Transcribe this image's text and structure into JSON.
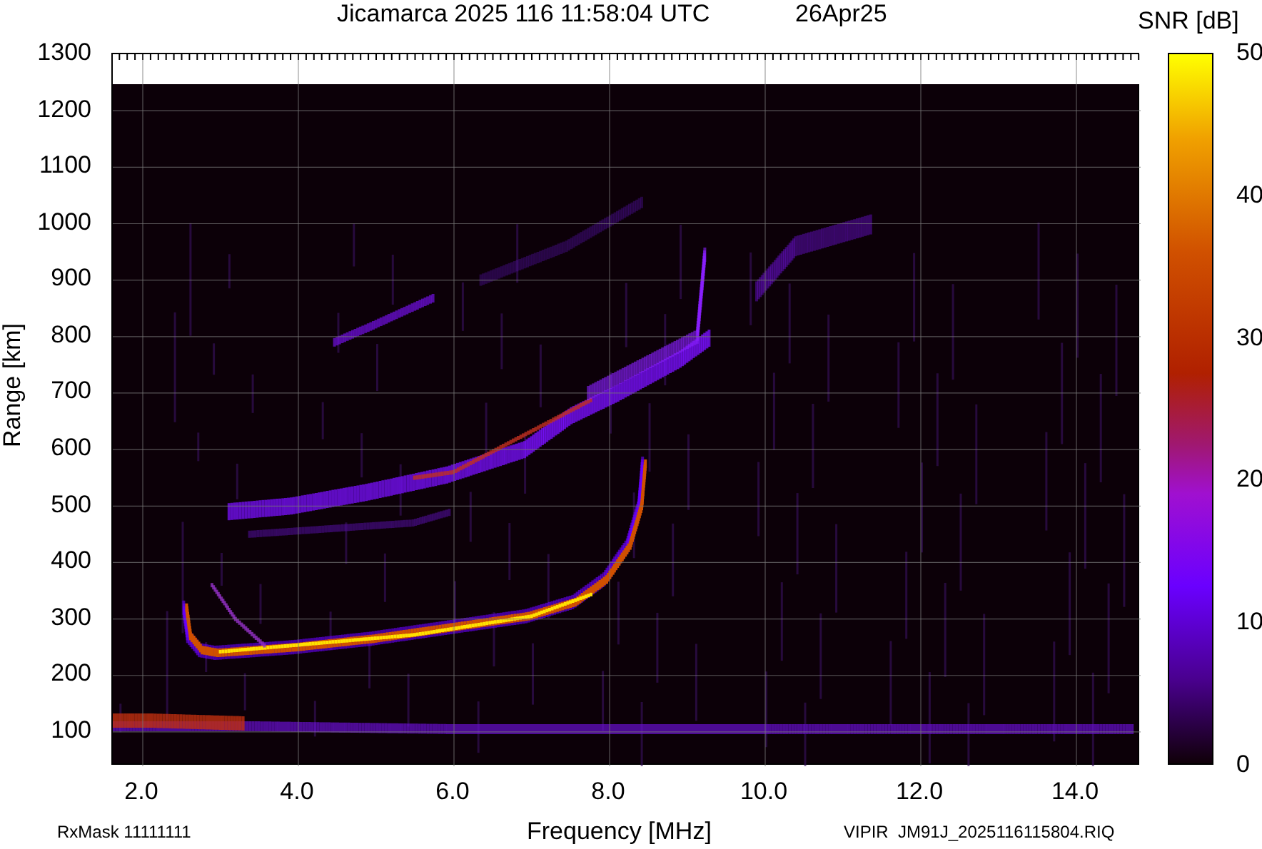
{
  "title": "Jicamarca 2025 116 11:58:04 UTC",
  "date": "26Apr25",
  "colorbar": {
    "label": "SNR [dB]",
    "ticks": [
      "50",
      "40",
      "30",
      "20",
      "10",
      "0"
    ]
  },
  "plot": {
    "y_axis": {
      "label": "Range [km]",
      "ticks": [
        "1300",
        "1200",
        "1100",
        "1000",
        "900",
        "800",
        "700",
        "600",
        "500",
        "400",
        "300",
        "200",
        "100"
      ]
    },
    "x_axis": {
      "label": "Frequency [MHz]",
      "ticks": [
        "2.0",
        "4.0",
        "6.0",
        "8.0",
        "10.0",
        "12.0",
        "14.0"
      ]
    }
  },
  "footer": {
    "rx_mask": "RxMask 11111111",
    "file": "VIPIR  JM91J_2025116115804.RIQ"
  }
}
